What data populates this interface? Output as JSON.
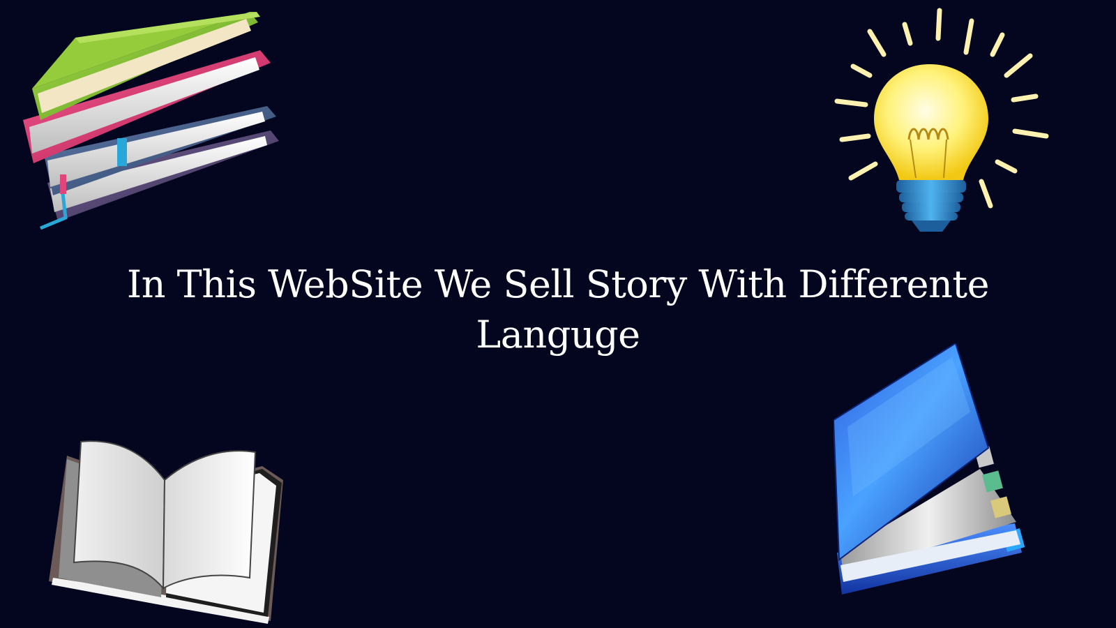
{
  "hero": {
    "headline": "In This WebSite We Sell Story With Differente Languge"
  },
  "illustrations": {
    "top_left": "stacked-books",
    "top_right": "lightbulb",
    "bottom_left": "open-book",
    "bottom_right": "blue-book"
  },
  "colors": {
    "background": "#03061e",
    "text": "#ffffff",
    "bulb_glow": "#fff27a",
    "bulb_base": "#2a8fd6",
    "book_green": "#8dc63f",
    "book_pink": "#e0457b",
    "book_blue": "#1f4fd1"
  }
}
